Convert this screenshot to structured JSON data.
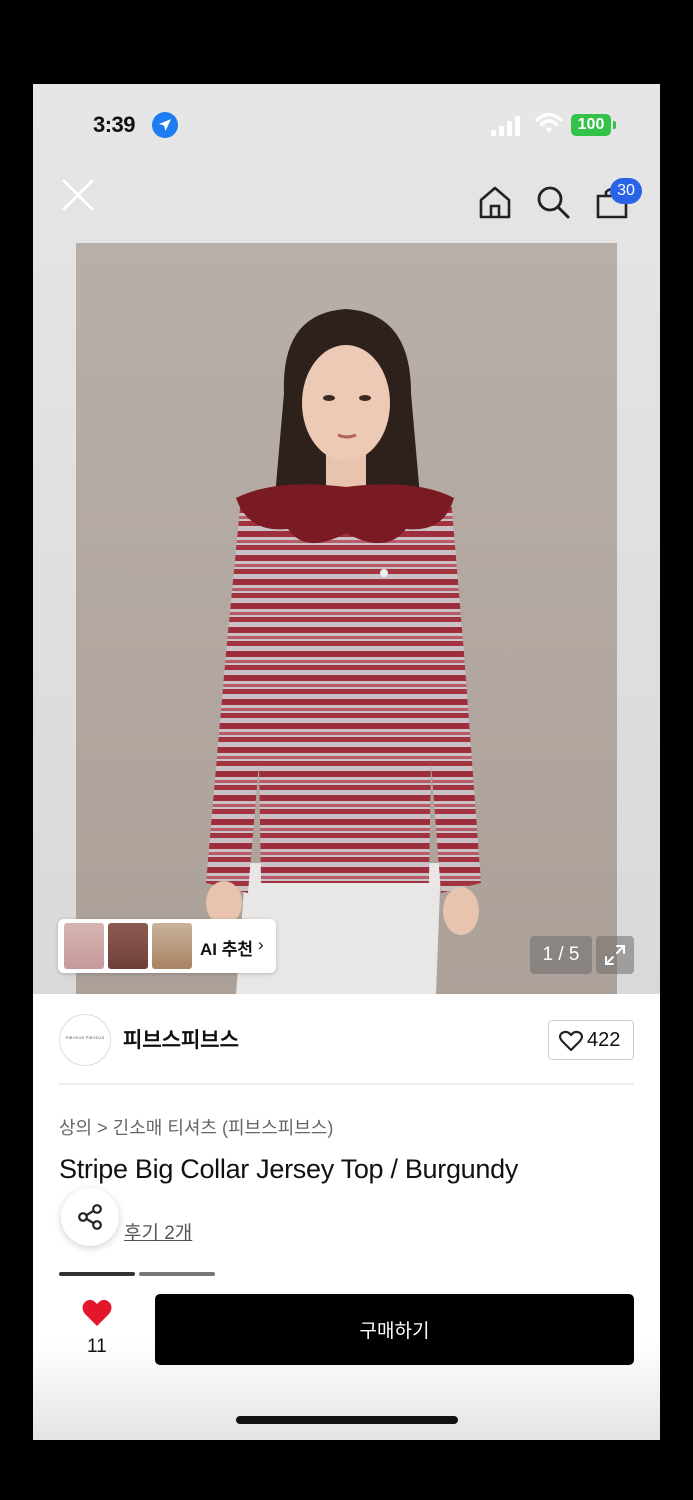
{
  "status_bar": {
    "time": "3:39",
    "battery": "100",
    "icons": [
      "location-icon",
      "signal-icon",
      "wifi-icon",
      "battery-icon"
    ]
  },
  "nav": {
    "icons": [
      "close-icon",
      "home-icon",
      "search-icon",
      "shopping-bag-icon"
    ],
    "cart_badge": "30"
  },
  "gallery": {
    "ai_label": "AI 추천",
    "ai_chevron": "›",
    "counter": "1 / 5"
  },
  "brand": {
    "logo_text": "PIBYEUS PIBYEUS",
    "name": "피브스피브스",
    "likes": "422"
  },
  "product": {
    "breadcrumb": "상의 > 긴소매 티셔츠 (피브스피브스)",
    "title": "Stripe Big Collar Jersey Top / Burgundy",
    "review": "후기 2개"
  },
  "bottom_bar": {
    "favorite_count": "11",
    "buy_label": "구매하기"
  },
  "colors": {
    "accent_blue": "#2a63e8",
    "battery_green": "#35c24a",
    "heart_red": "#e3162b",
    "buy_button": "#000000"
  }
}
